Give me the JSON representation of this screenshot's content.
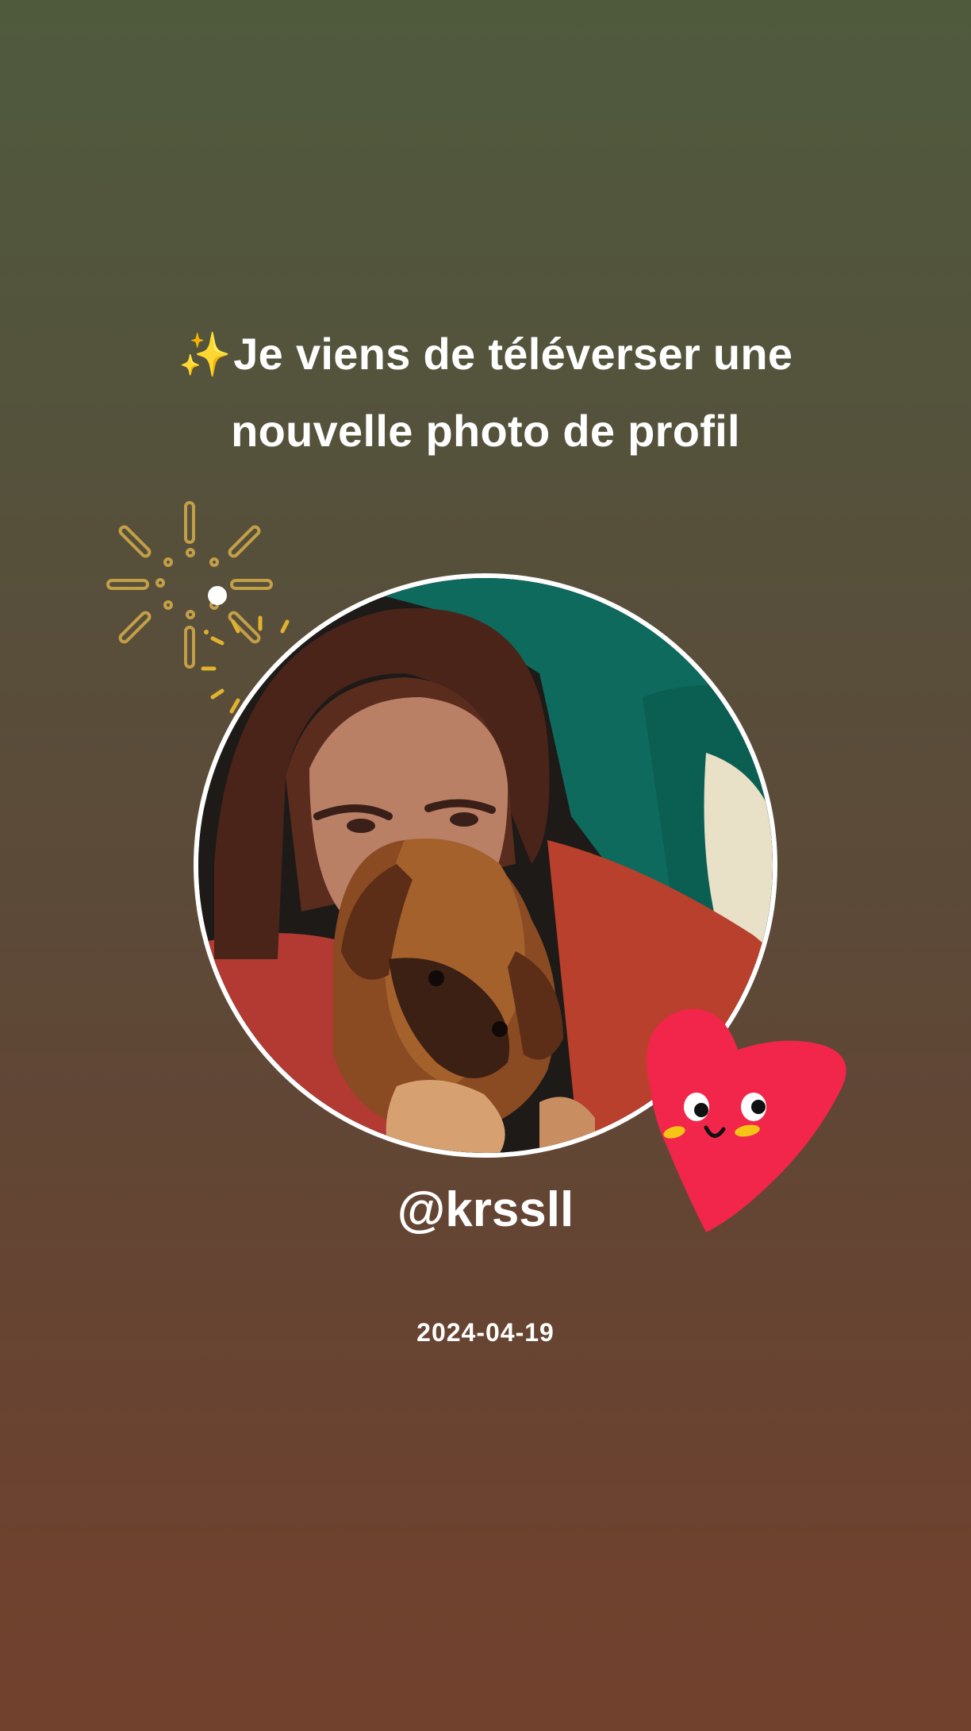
{
  "headline": {
    "sparkle_icon": "✨",
    "line1": "Je viens de téléverser une",
    "line2": "nouvelle photo de profil"
  },
  "profile": {
    "username": "@krssll",
    "date": "2024-04-19",
    "avatar_description_icon": "profile-photo"
  },
  "decorations": {
    "fireworks_icon": "fireworks-icon",
    "heart_icon": "smiling-heart-icon"
  },
  "colors": {
    "background_top": "#4f5a3d",
    "background_bottom": "#72412d",
    "heart": "#f2264a",
    "fireworks_gold": "#d9b24a",
    "ring": "#ffffff"
  }
}
